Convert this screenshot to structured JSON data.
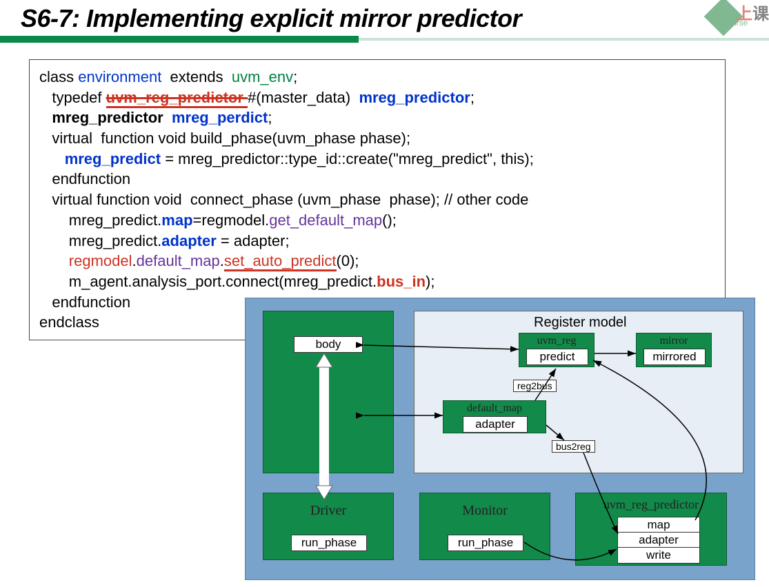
{
  "slide": {
    "title": "S6-7: Implementing explicit mirror predictor"
  },
  "logo": {
    "char1": "上",
    "char2": "课",
    "sub": "irse"
  },
  "code": {
    "l1a": "class ",
    "l1b": "environment",
    "l1c": "  extends  ",
    "l1d": "uvm_env",
    "l1e": ";",
    "l2a": "   typedef ",
    "l2b": "uvm_reg_predictor ",
    "l2c": "#(master_data)  ",
    "l2d": "mreg_predictor",
    "l2e": ";",
    "l3a": "   ",
    "l3b": "mreg_predictor  ",
    "l3c": "mreg_perdict",
    "l3d": ";",
    "l4": "   virtual  function void build_phase(uvm_phase phase);",
    "l5a": "      ",
    "l5b": "mreg_predict",
    "l5c": " = mreg_predictor::type_id::create(\"mreg_predict\", this);",
    "l6": "   endfunction",
    "l7": "   virtual function void  connect_phase (uvm_phase  phase); // other code",
    "l8a": "       mreg_predict.",
    "l8b": "map",
    "l8c": "=regmodel.",
    "l8d": "get_default_map",
    "l8e": "();",
    "l9a": "       mreg_predict.",
    "l9b": "adapter",
    "l9c": " = adapter;",
    "l10a": "       ",
    "l10b": "regmodel",
    "l10c": ".",
    "l10d": "default_map",
    "l10e": ".",
    "l10f": "set_auto_predict",
    "l10g": "(0);",
    "l11a": "       m_agent.analysis_port.connect(mreg_predict.",
    "l11b": "bus_in",
    "l11c": ");",
    "l12": "   endfunction",
    "l13": "endclass"
  },
  "diagram": {
    "register_model_title": "Register model",
    "body": "body",
    "uvm_reg": "uvm_reg",
    "predict": "predict",
    "mirror": "mirror",
    "mirrored": "mirrored",
    "default_map": "default_map",
    "adapter": "adapter",
    "reg2bus": "reg2bus",
    "bus2reg": "bus2reg",
    "driver": "Driver",
    "monitor": "Monitor",
    "run_phase": "run_phase",
    "uvm_reg_predictor": "uvm_reg_predictor",
    "map": "map",
    "write": "write"
  }
}
